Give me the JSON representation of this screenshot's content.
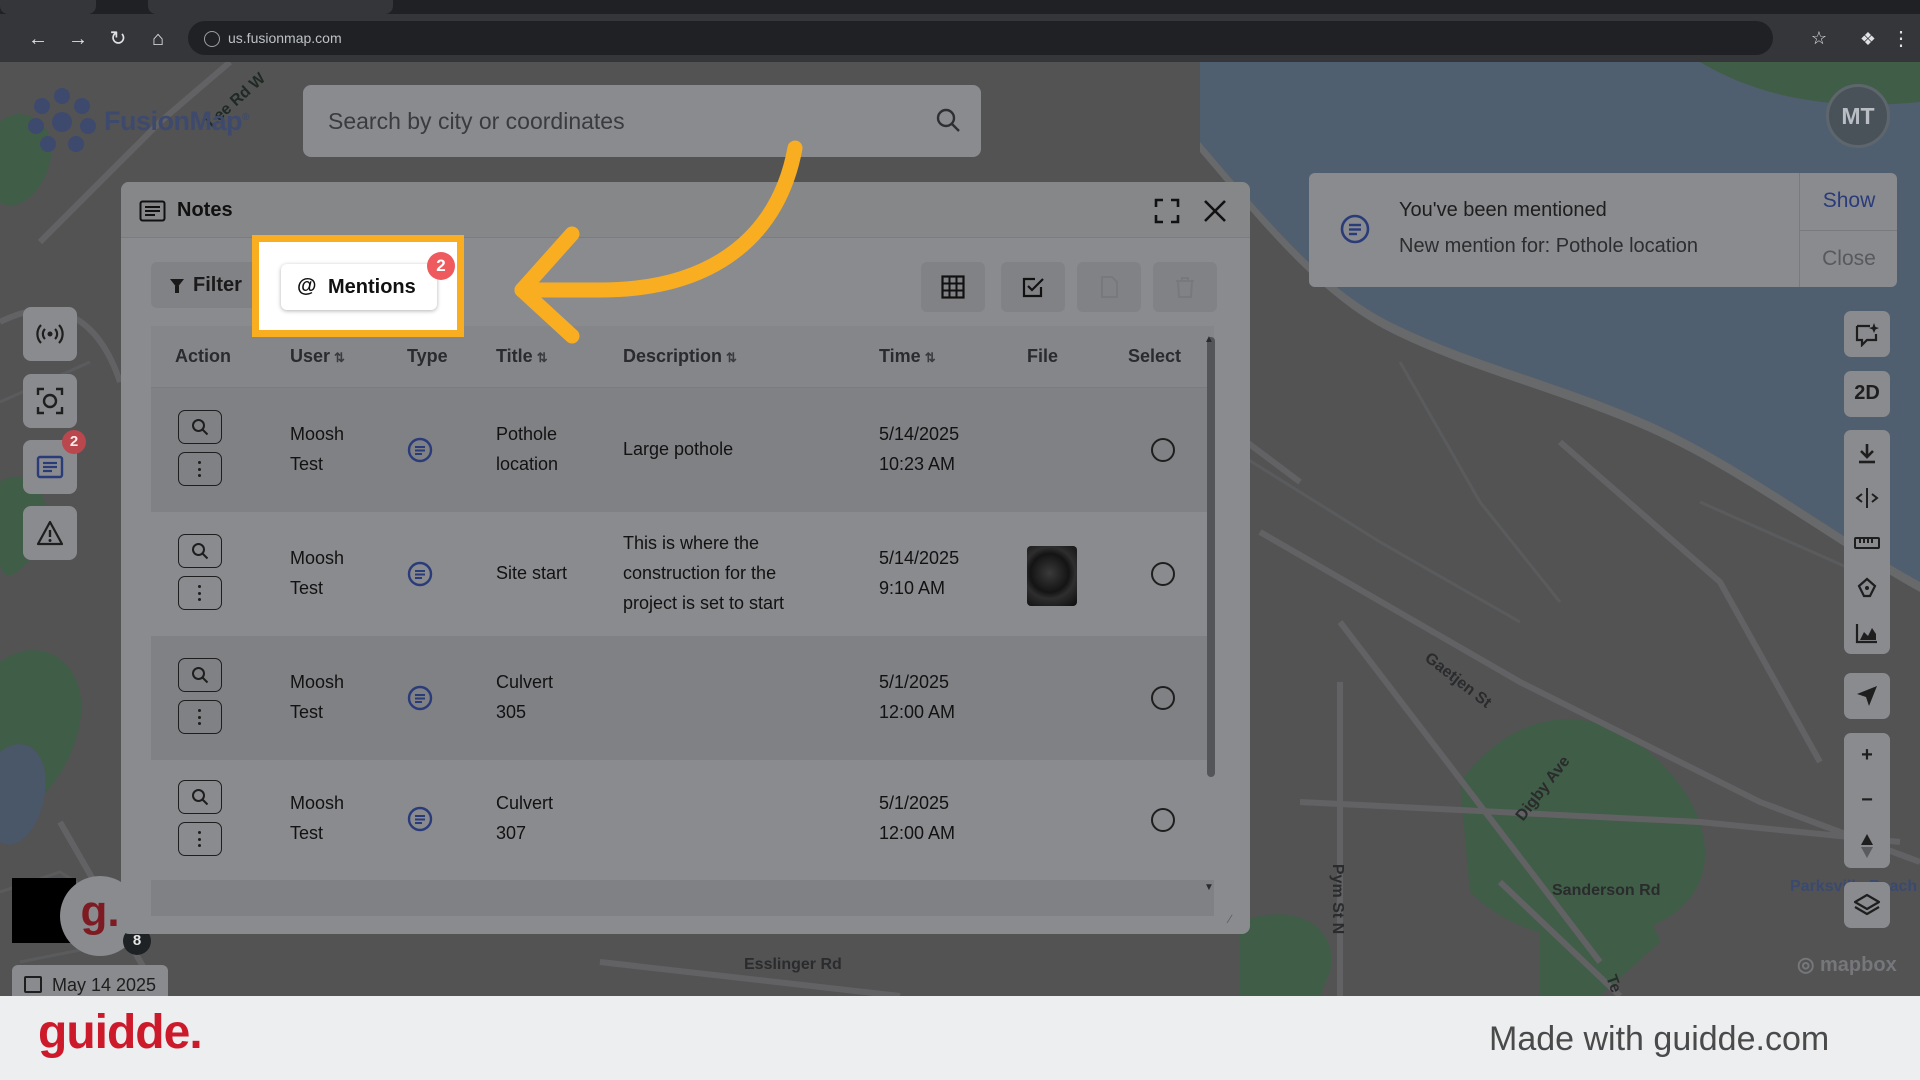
{
  "browser": {
    "url": "us.fusionmap.com"
  },
  "app": {
    "logo_text": "FusionMap",
    "search_placeholder": "Search by city or coordinates",
    "user_initials": "MT",
    "notes_badge": "2",
    "g_badge": "8",
    "g_letter": "g.",
    "date": "May 14 2025",
    "attribution": "mapbox"
  },
  "map_labels": {
    "lee_rd": "Lee Rd W",
    "gaetjen_st": "Gaetjen St",
    "digby_ave": "Digby Ave",
    "pym_st": "Pym St N",
    "sanderson_rd": "Sanderson Rd",
    "parksville": "Parksville Beach",
    "esslinger_rd": "Esslinger Rd",
    "te": "Te"
  },
  "right_controls": {
    "mode_2d": "2D"
  },
  "toast": {
    "title": "You've been mentioned",
    "message": "New mention for: Pothole location",
    "show_label": "Show",
    "close_label": "Close"
  },
  "notes": {
    "title": "Notes",
    "filter_label": "Filter",
    "mentions_label": "Mentions",
    "mentions_count": "2",
    "columns": {
      "action": "Action",
      "user": "User",
      "type": "Type",
      "title": "Title",
      "description": "Description",
      "time": "Time",
      "file": "File",
      "select": "Select"
    },
    "rows": [
      {
        "user1": "Moosh",
        "user2": "Test",
        "title1": "Pothole",
        "title2": "location",
        "desc1": "Large pothole",
        "desc2": "",
        "desc3": "",
        "date": "5/14/2025",
        "time": "10:23 AM"
      },
      {
        "user1": "Moosh",
        "user2": "Test",
        "title1": "Site start",
        "title2": "",
        "desc1": "This is where the",
        "desc2": "construction for the",
        "desc3": "project is set to start",
        "date": "5/14/2025",
        "time": "9:10 AM"
      },
      {
        "user1": "Moosh",
        "user2": "Test",
        "title1": "Culvert",
        "title2": "305",
        "desc1": "",
        "desc2": "",
        "desc3": "",
        "date": "5/1/2025",
        "time": "12:00 AM"
      },
      {
        "user1": "Moosh",
        "user2": "Test",
        "title1": "Culvert",
        "title2": "307",
        "desc1": "",
        "desc2": "",
        "desc3": "",
        "date": "5/1/2025",
        "time": "12:00 AM"
      }
    ]
  },
  "footer": {
    "brand": "guidde.",
    "made_with": "Made with guidde.com"
  }
}
